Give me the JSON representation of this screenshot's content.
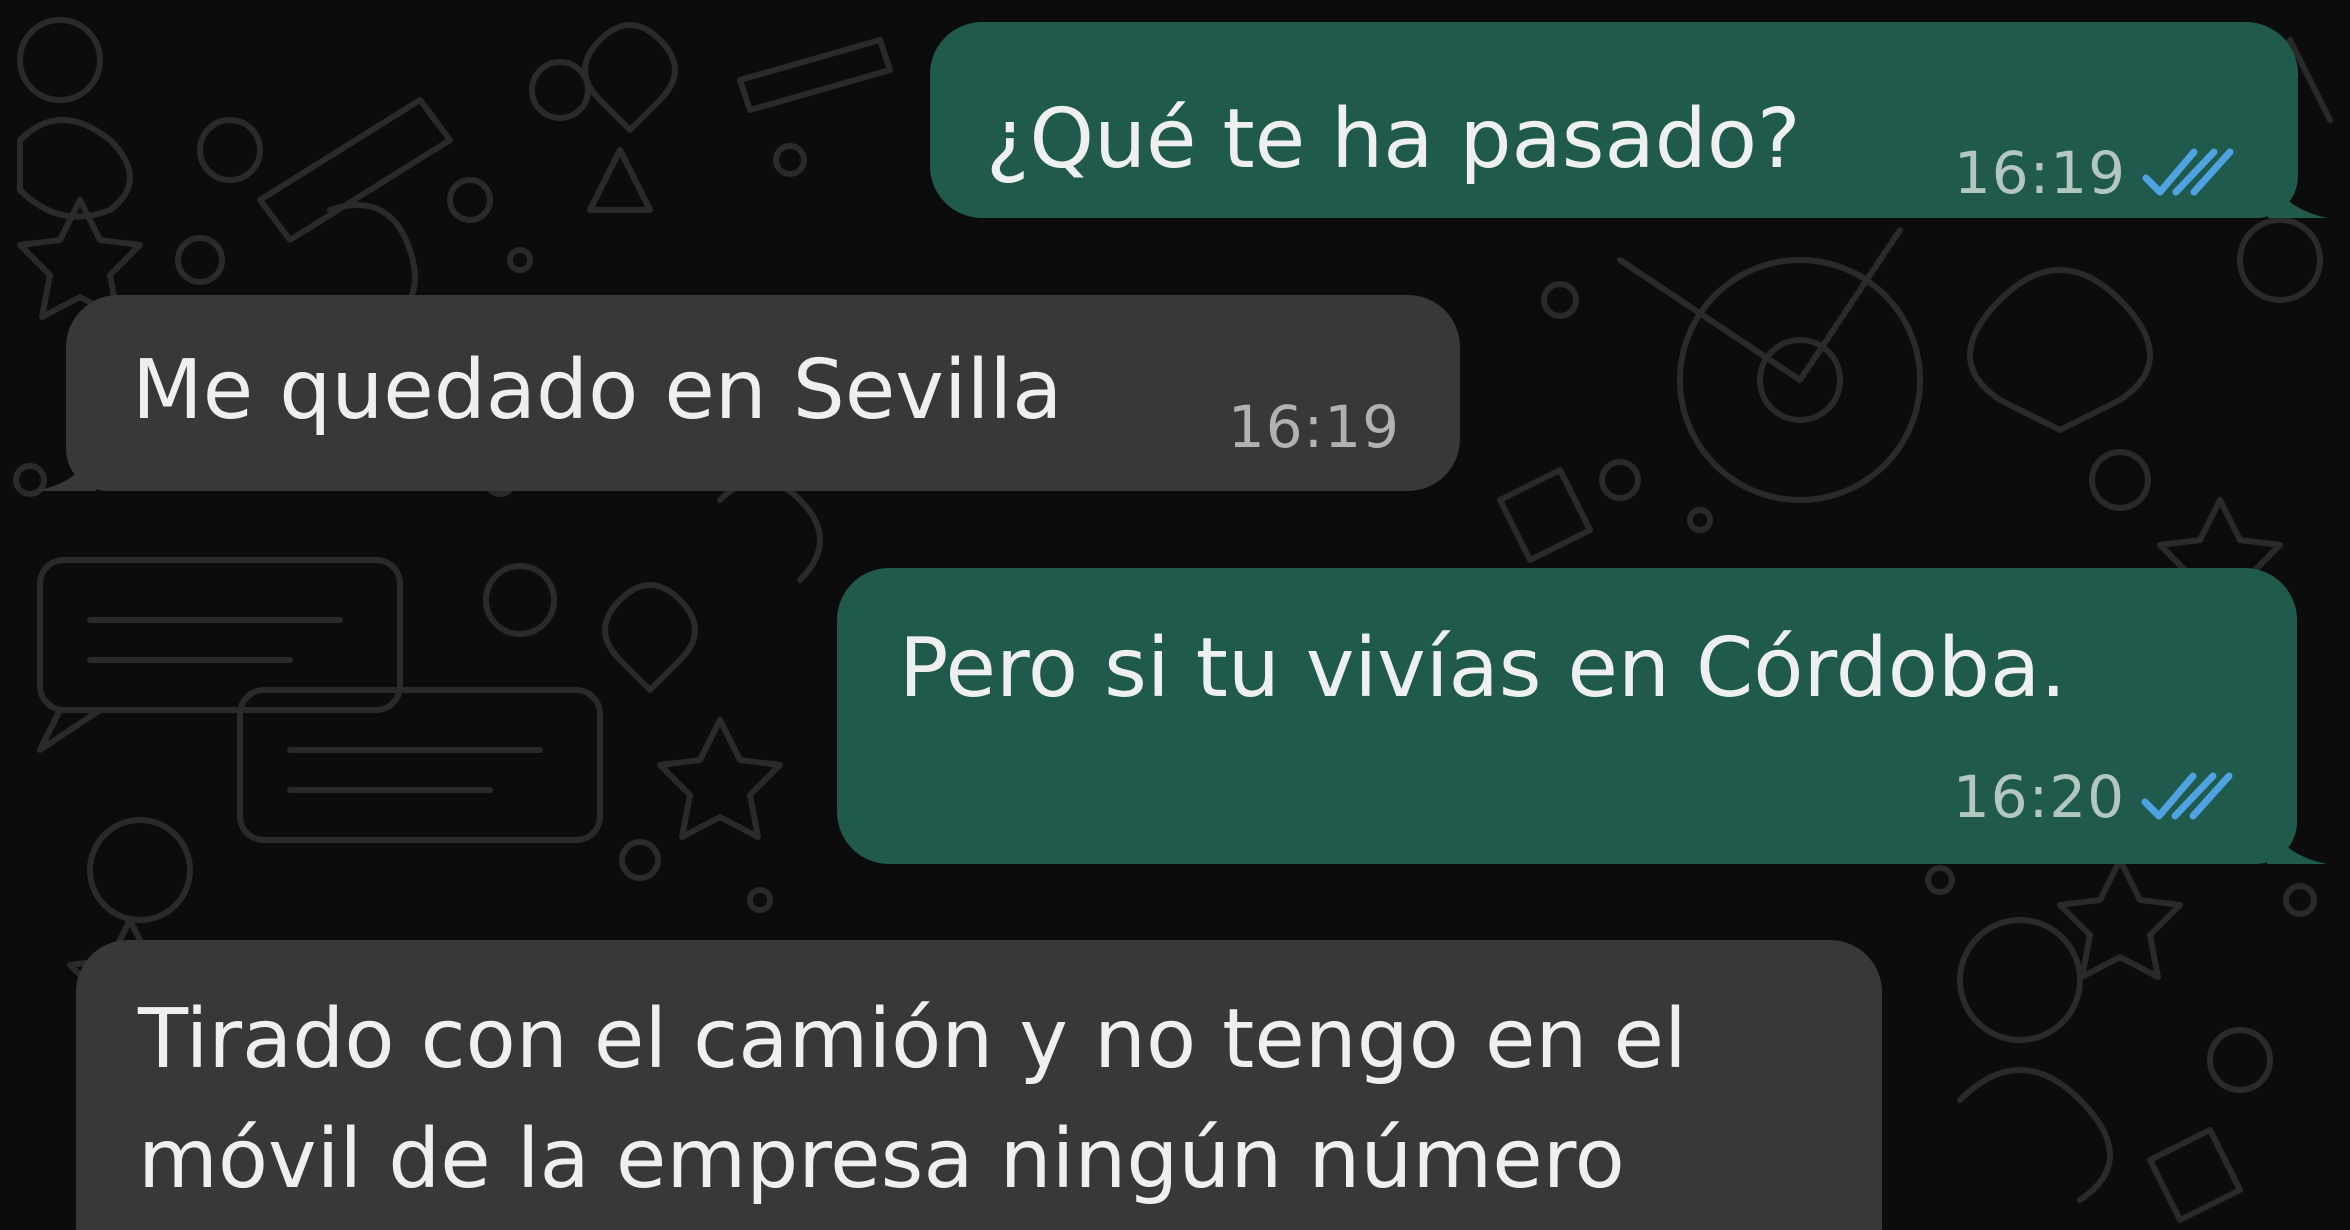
{
  "colors": {
    "background": "#0c0c0c",
    "wallpaper_doodle": "#2a2a2a",
    "outgoing_bubble": "#1f5a4c",
    "incoming_bubble": "#383838",
    "message_text": "#eef0f0",
    "read_ticks": "#4fa3e0"
  },
  "messages": [
    {
      "direction": "outgoing",
      "text": "¿Qué te ha pasado?",
      "time": "16:19",
      "status_icon": "double-check-read-icon"
    },
    {
      "direction": "incoming",
      "text": "Me quedado en Sevilla",
      "time": "16:19"
    },
    {
      "direction": "outgoing",
      "text": "Pero si tu vivías en Córdoba.",
      "time": "16:20",
      "status_icon": "double-check-read-icon"
    },
    {
      "direction": "incoming",
      "text_lines": [
        "Tirado con el camión y no tengo en el",
        "móvil de la empresa ningún número"
      ]
    }
  ]
}
